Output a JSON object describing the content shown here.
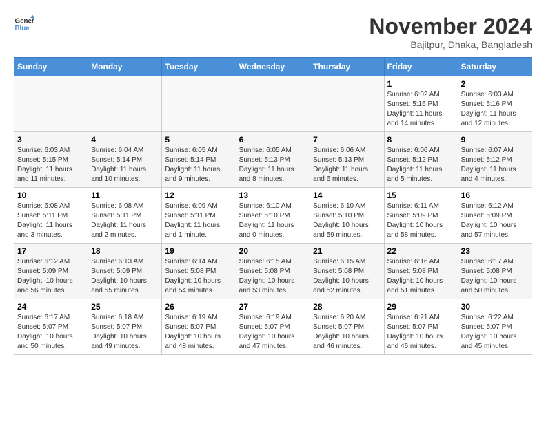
{
  "header": {
    "logo_line1": "General",
    "logo_line2": "Blue",
    "month": "November 2024",
    "location": "Bajitpur, Dhaka, Bangladesh"
  },
  "days_of_week": [
    "Sunday",
    "Monday",
    "Tuesday",
    "Wednesday",
    "Thursday",
    "Friday",
    "Saturday"
  ],
  "weeks": [
    [
      {
        "day": "",
        "info": ""
      },
      {
        "day": "",
        "info": ""
      },
      {
        "day": "",
        "info": ""
      },
      {
        "day": "",
        "info": ""
      },
      {
        "day": "",
        "info": ""
      },
      {
        "day": "1",
        "info": "Sunrise: 6:02 AM\nSunset: 5:16 PM\nDaylight: 11 hours and 14 minutes."
      },
      {
        "day": "2",
        "info": "Sunrise: 6:03 AM\nSunset: 5:16 PM\nDaylight: 11 hours and 12 minutes."
      }
    ],
    [
      {
        "day": "3",
        "info": "Sunrise: 6:03 AM\nSunset: 5:15 PM\nDaylight: 11 hours and 11 minutes."
      },
      {
        "day": "4",
        "info": "Sunrise: 6:04 AM\nSunset: 5:14 PM\nDaylight: 11 hours and 10 minutes."
      },
      {
        "day": "5",
        "info": "Sunrise: 6:05 AM\nSunset: 5:14 PM\nDaylight: 11 hours and 9 minutes."
      },
      {
        "day": "6",
        "info": "Sunrise: 6:05 AM\nSunset: 5:13 PM\nDaylight: 11 hours and 8 minutes."
      },
      {
        "day": "7",
        "info": "Sunrise: 6:06 AM\nSunset: 5:13 PM\nDaylight: 11 hours and 6 minutes."
      },
      {
        "day": "8",
        "info": "Sunrise: 6:06 AM\nSunset: 5:12 PM\nDaylight: 11 hours and 5 minutes."
      },
      {
        "day": "9",
        "info": "Sunrise: 6:07 AM\nSunset: 5:12 PM\nDaylight: 11 hours and 4 minutes."
      }
    ],
    [
      {
        "day": "10",
        "info": "Sunrise: 6:08 AM\nSunset: 5:11 PM\nDaylight: 11 hours and 3 minutes."
      },
      {
        "day": "11",
        "info": "Sunrise: 6:08 AM\nSunset: 5:11 PM\nDaylight: 11 hours and 2 minutes."
      },
      {
        "day": "12",
        "info": "Sunrise: 6:09 AM\nSunset: 5:11 PM\nDaylight: 11 hours and 1 minute."
      },
      {
        "day": "13",
        "info": "Sunrise: 6:10 AM\nSunset: 5:10 PM\nDaylight: 11 hours and 0 minutes."
      },
      {
        "day": "14",
        "info": "Sunrise: 6:10 AM\nSunset: 5:10 PM\nDaylight: 10 hours and 59 minutes."
      },
      {
        "day": "15",
        "info": "Sunrise: 6:11 AM\nSunset: 5:09 PM\nDaylight: 10 hours and 58 minutes."
      },
      {
        "day": "16",
        "info": "Sunrise: 6:12 AM\nSunset: 5:09 PM\nDaylight: 10 hours and 57 minutes."
      }
    ],
    [
      {
        "day": "17",
        "info": "Sunrise: 6:12 AM\nSunset: 5:09 PM\nDaylight: 10 hours and 56 minutes."
      },
      {
        "day": "18",
        "info": "Sunrise: 6:13 AM\nSunset: 5:09 PM\nDaylight: 10 hours and 55 minutes."
      },
      {
        "day": "19",
        "info": "Sunrise: 6:14 AM\nSunset: 5:08 PM\nDaylight: 10 hours and 54 minutes."
      },
      {
        "day": "20",
        "info": "Sunrise: 6:15 AM\nSunset: 5:08 PM\nDaylight: 10 hours and 53 minutes."
      },
      {
        "day": "21",
        "info": "Sunrise: 6:15 AM\nSunset: 5:08 PM\nDaylight: 10 hours and 52 minutes."
      },
      {
        "day": "22",
        "info": "Sunrise: 6:16 AM\nSunset: 5:08 PM\nDaylight: 10 hours and 51 minutes."
      },
      {
        "day": "23",
        "info": "Sunrise: 6:17 AM\nSunset: 5:08 PM\nDaylight: 10 hours and 50 minutes."
      }
    ],
    [
      {
        "day": "24",
        "info": "Sunrise: 6:17 AM\nSunset: 5:07 PM\nDaylight: 10 hours and 50 minutes."
      },
      {
        "day": "25",
        "info": "Sunrise: 6:18 AM\nSunset: 5:07 PM\nDaylight: 10 hours and 49 minutes."
      },
      {
        "day": "26",
        "info": "Sunrise: 6:19 AM\nSunset: 5:07 PM\nDaylight: 10 hours and 48 minutes."
      },
      {
        "day": "27",
        "info": "Sunrise: 6:19 AM\nSunset: 5:07 PM\nDaylight: 10 hours and 47 minutes."
      },
      {
        "day": "28",
        "info": "Sunrise: 6:20 AM\nSunset: 5:07 PM\nDaylight: 10 hours and 46 minutes."
      },
      {
        "day": "29",
        "info": "Sunrise: 6:21 AM\nSunset: 5:07 PM\nDaylight: 10 hours and 46 minutes."
      },
      {
        "day": "30",
        "info": "Sunrise: 6:22 AM\nSunset: 5:07 PM\nDaylight: 10 hours and 45 minutes."
      }
    ]
  ]
}
